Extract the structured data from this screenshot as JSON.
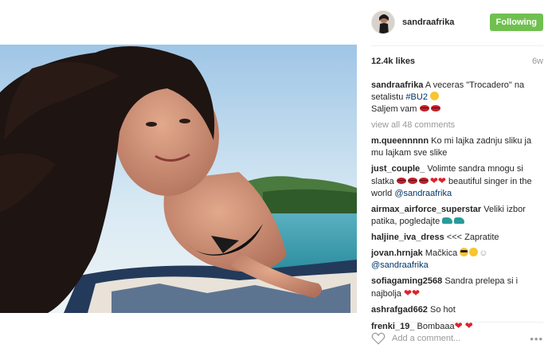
{
  "post": {
    "author": "sandraafrika",
    "follow_label": "Following",
    "likes": "12.4k likes",
    "time_ago": "6w"
  },
  "caption": {
    "username": "sandraafrika",
    "text_before_tag": "A veceras \"Trocadero\" na setalistu",
    "hashtag": "#BU2",
    "text_line2": "Saljem vam"
  },
  "view_all_comments": "view all 48 comments",
  "comments": [
    {
      "username": "m.queennnnn",
      "text": "Ko mi lajka zadnju sliku ja mu lajkam sve slike"
    },
    {
      "username": "just_couple_",
      "text_a": "Volimte sandra mnogu si slatka",
      "text_b": "beautiful singer in the world",
      "mention": "@sandraafrika"
    },
    {
      "username": "airmax_airforce_superstar",
      "text": "Veliki izbor patika, pogledajte"
    },
    {
      "username": "haljine_iva_dress",
      "text": "<<< Zapratite"
    },
    {
      "username": "jovan.hrnjak",
      "text": "Mačkica",
      "mention": "@sandraafrika"
    },
    {
      "username": "sofiagaming2568",
      "text": "Sandra prelepa si i najbolja"
    },
    {
      "username": "ashrafgad662",
      "text": "So hot"
    },
    {
      "username": "frenki_19_",
      "text": "Bombaaa"
    }
  ],
  "footer": {
    "add_comment_placeholder": "Add a comment...",
    "more_label": "•••"
  },
  "icons": {
    "like": "heart-outline-icon",
    "more": "ellipsis-icon"
  }
}
